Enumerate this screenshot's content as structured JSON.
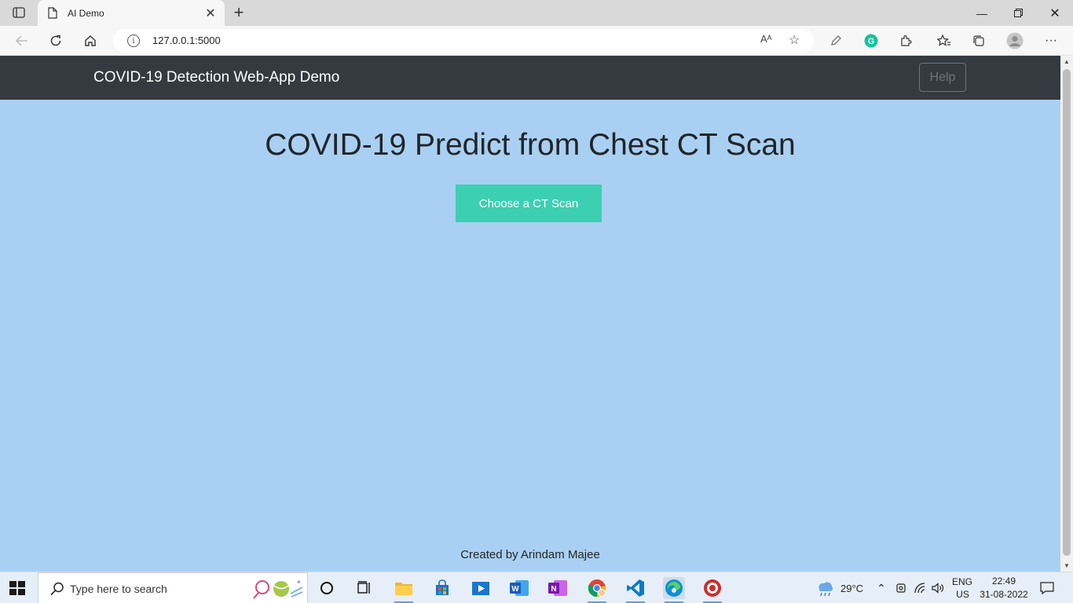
{
  "browser": {
    "tab_title": "AI Demo",
    "url": "127.0.0.1:5000",
    "read_aloud": "A"
  },
  "navbar": {
    "brand": "COVID-19 Detection Web-App Demo",
    "help_label": "Help"
  },
  "main": {
    "heading": "COVID-19 Predict from Chest CT Scan",
    "choose_button": "Choose a CT Scan",
    "footer": "Created by Arindam Majee"
  },
  "taskbar": {
    "search_placeholder": "Type here to search",
    "weather": "29°C",
    "lang_top": "ENG",
    "lang_bottom": "US",
    "time": "22:49",
    "date": "31-08-2022"
  },
  "colors": {
    "page_bg": "#a9d0f2",
    "navbar_bg": "#343a40",
    "button_bg": "#3ccfb2"
  }
}
